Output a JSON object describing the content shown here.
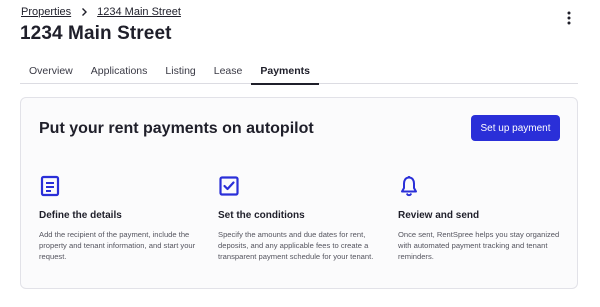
{
  "breadcrumb": {
    "parent": "Properties",
    "current": "1234 Main Street"
  },
  "page": {
    "title": "1234 Main Street"
  },
  "tabs": [
    {
      "label": "Overview"
    },
    {
      "label": "Applications"
    },
    {
      "label": "Listing"
    },
    {
      "label": "Lease"
    },
    {
      "label": "Payments",
      "active": true
    }
  ],
  "card": {
    "heading": "Put your rent payments on autopilot",
    "cta_label": "Set up payment",
    "accent_color": "#2a2fd8",
    "steps": [
      {
        "icon": "document-icon",
        "title": "Define the details",
        "description": "Add the recipient of the payment, include the property and tenant information, and start your request."
      },
      {
        "icon": "checkbox-icon",
        "title": "Set the conditions",
        "description": "Specify the amounts and due dates for rent, deposits, and any applicable fees to create a transparent payment schedule for your tenant."
      },
      {
        "icon": "bell-icon",
        "title": "Review and send",
        "description": "Once sent, RentSpree helps you stay organized with automated payment tracking and tenant reminders."
      }
    ]
  }
}
